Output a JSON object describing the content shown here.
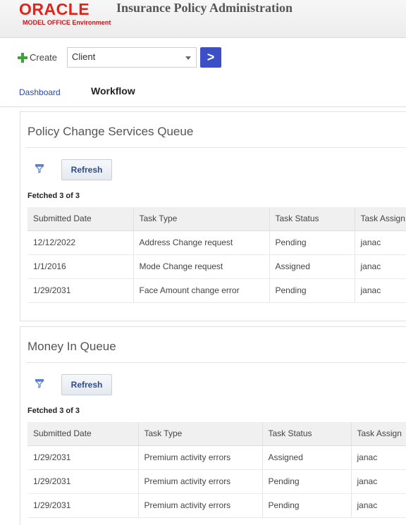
{
  "header": {
    "logo": "ORACLE",
    "app_title": "Insurance Policy Administration",
    "environment": "MODEL OFFICE Environment"
  },
  "toolbar": {
    "create_label": "Create",
    "client_select_value": "Client",
    "go_label": ">"
  },
  "tabs": {
    "dashboard": "Dashboard",
    "workflow": "Workflow"
  },
  "panels": [
    {
      "title": "Policy Change Services Queue",
      "refresh_label": "Refresh",
      "fetched": "Fetched 3 of 3",
      "columns": [
        "Submitted Date",
        "Task Type",
        "Task Status",
        "Task Assign"
      ],
      "rows": [
        [
          "12/12/2022",
          "Address Change request",
          "Pending",
          "janac"
        ],
        [
          "1/1/2016",
          "Mode Change request",
          "Assigned",
          "janac"
        ],
        [
          "1/29/2031",
          "Face Amount change error",
          "Pending",
          "janac"
        ]
      ]
    },
    {
      "title": "Money In Queue",
      "refresh_label": "Refresh",
      "fetched": "Fetched 3 of 3",
      "columns": [
        "Submitted Date",
        "Task Type",
        "Task Status",
        "Task Assign"
      ],
      "rows": [
        [
          "1/29/2031",
          "Premium activity errors",
          "Assigned",
          "janac"
        ],
        [
          "1/29/2031",
          "Premium activity errors",
          "Pending",
          "janac"
        ],
        [
          "1/29/2031",
          "Premium activity errors",
          "Pending",
          "janac"
        ]
      ]
    }
  ],
  "colors": {
    "brand": "#e2231a",
    "accent": "#3b50c8",
    "link": "#2b4a9e"
  }
}
